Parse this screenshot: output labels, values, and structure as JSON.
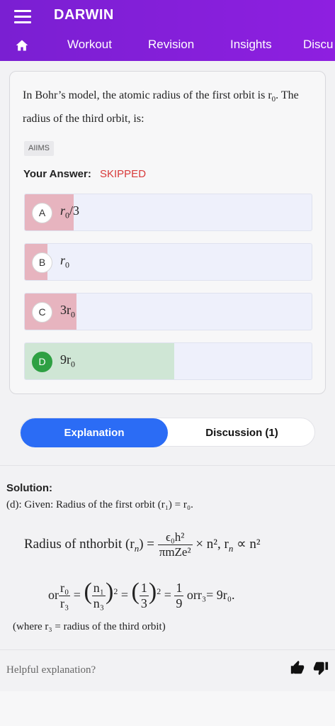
{
  "app": {
    "title": "DARWIN",
    "menu_icon": "hamburger-menu-icon",
    "home_icon": "home-icon"
  },
  "tabs": [
    "Workout",
    "Revision",
    "Insights",
    "Discu"
  ],
  "question": {
    "text_before": "In Bohr’s model, the atomic radius of the first orbit is r",
    "sub": "0",
    "text_after": ". The radius of the third orbit, is:",
    "tag": "AIIMS",
    "answer_label": "Your Answer:",
    "answer_value": "SKIPPED",
    "options": [
      {
        "letter": "A",
        "text": "r",
        "sub": "0",
        "suffix": "/3",
        "percent": 17,
        "status": "wrong"
      },
      {
        "letter": "B",
        "text": "r",
        "sub": "0",
        "suffix": "",
        "percent": 8,
        "status": "wrong"
      },
      {
        "letter": "C",
        "text": "3r",
        "sub": "0",
        "suffix": "",
        "percent": 18,
        "status": "wrong"
      },
      {
        "letter": "D",
        "text": "9r",
        "sub": "0",
        "suffix": "",
        "percent": 52,
        "status": "correct"
      }
    ]
  },
  "toggle": {
    "explanation": "Explanation",
    "discussion": "Discussion (1)"
  },
  "solution": {
    "title": "Solution:",
    "given": "(d): Given: Radius of the first orbit (r₁) = r₀.",
    "eq1_lhs": "Radius of nthorbit (r",
    "eq1_lhs_sub": "n",
    "eq1_lhs_close": ") =",
    "eq1_num": "ϵ₀h²",
    "eq1_den": "πmZe²",
    "eq1_rhs": "× n², r",
    "eq1_rhs_sub": "n",
    "eq1_rhs_end": "∝ n²",
    "eq2_or": "or",
    "eq2_num1": "r₀",
    "eq2_den1": "r₃",
    "eq2_num2": "n₁",
    "eq2_den2": "n₃",
    "eq2_num3": "1",
    "eq2_den3": "3",
    "eq2_num4": "1",
    "eq2_den4": "9",
    "eq2_tail": "orr₃= 9r₀.",
    "where": "(where r₃ = radius of the third orbit)"
  },
  "feedback": {
    "label": "Helpful explanation?",
    "up_icon": "thumbs-up-icon",
    "down_icon": "thumbs-down-icon"
  },
  "colors": {
    "appbar": "#8e1fe0",
    "accent": "#2b6cf5",
    "wrong": "#e7b4bf",
    "correct": "#2ea043",
    "skipped": "#d83a3a"
  }
}
